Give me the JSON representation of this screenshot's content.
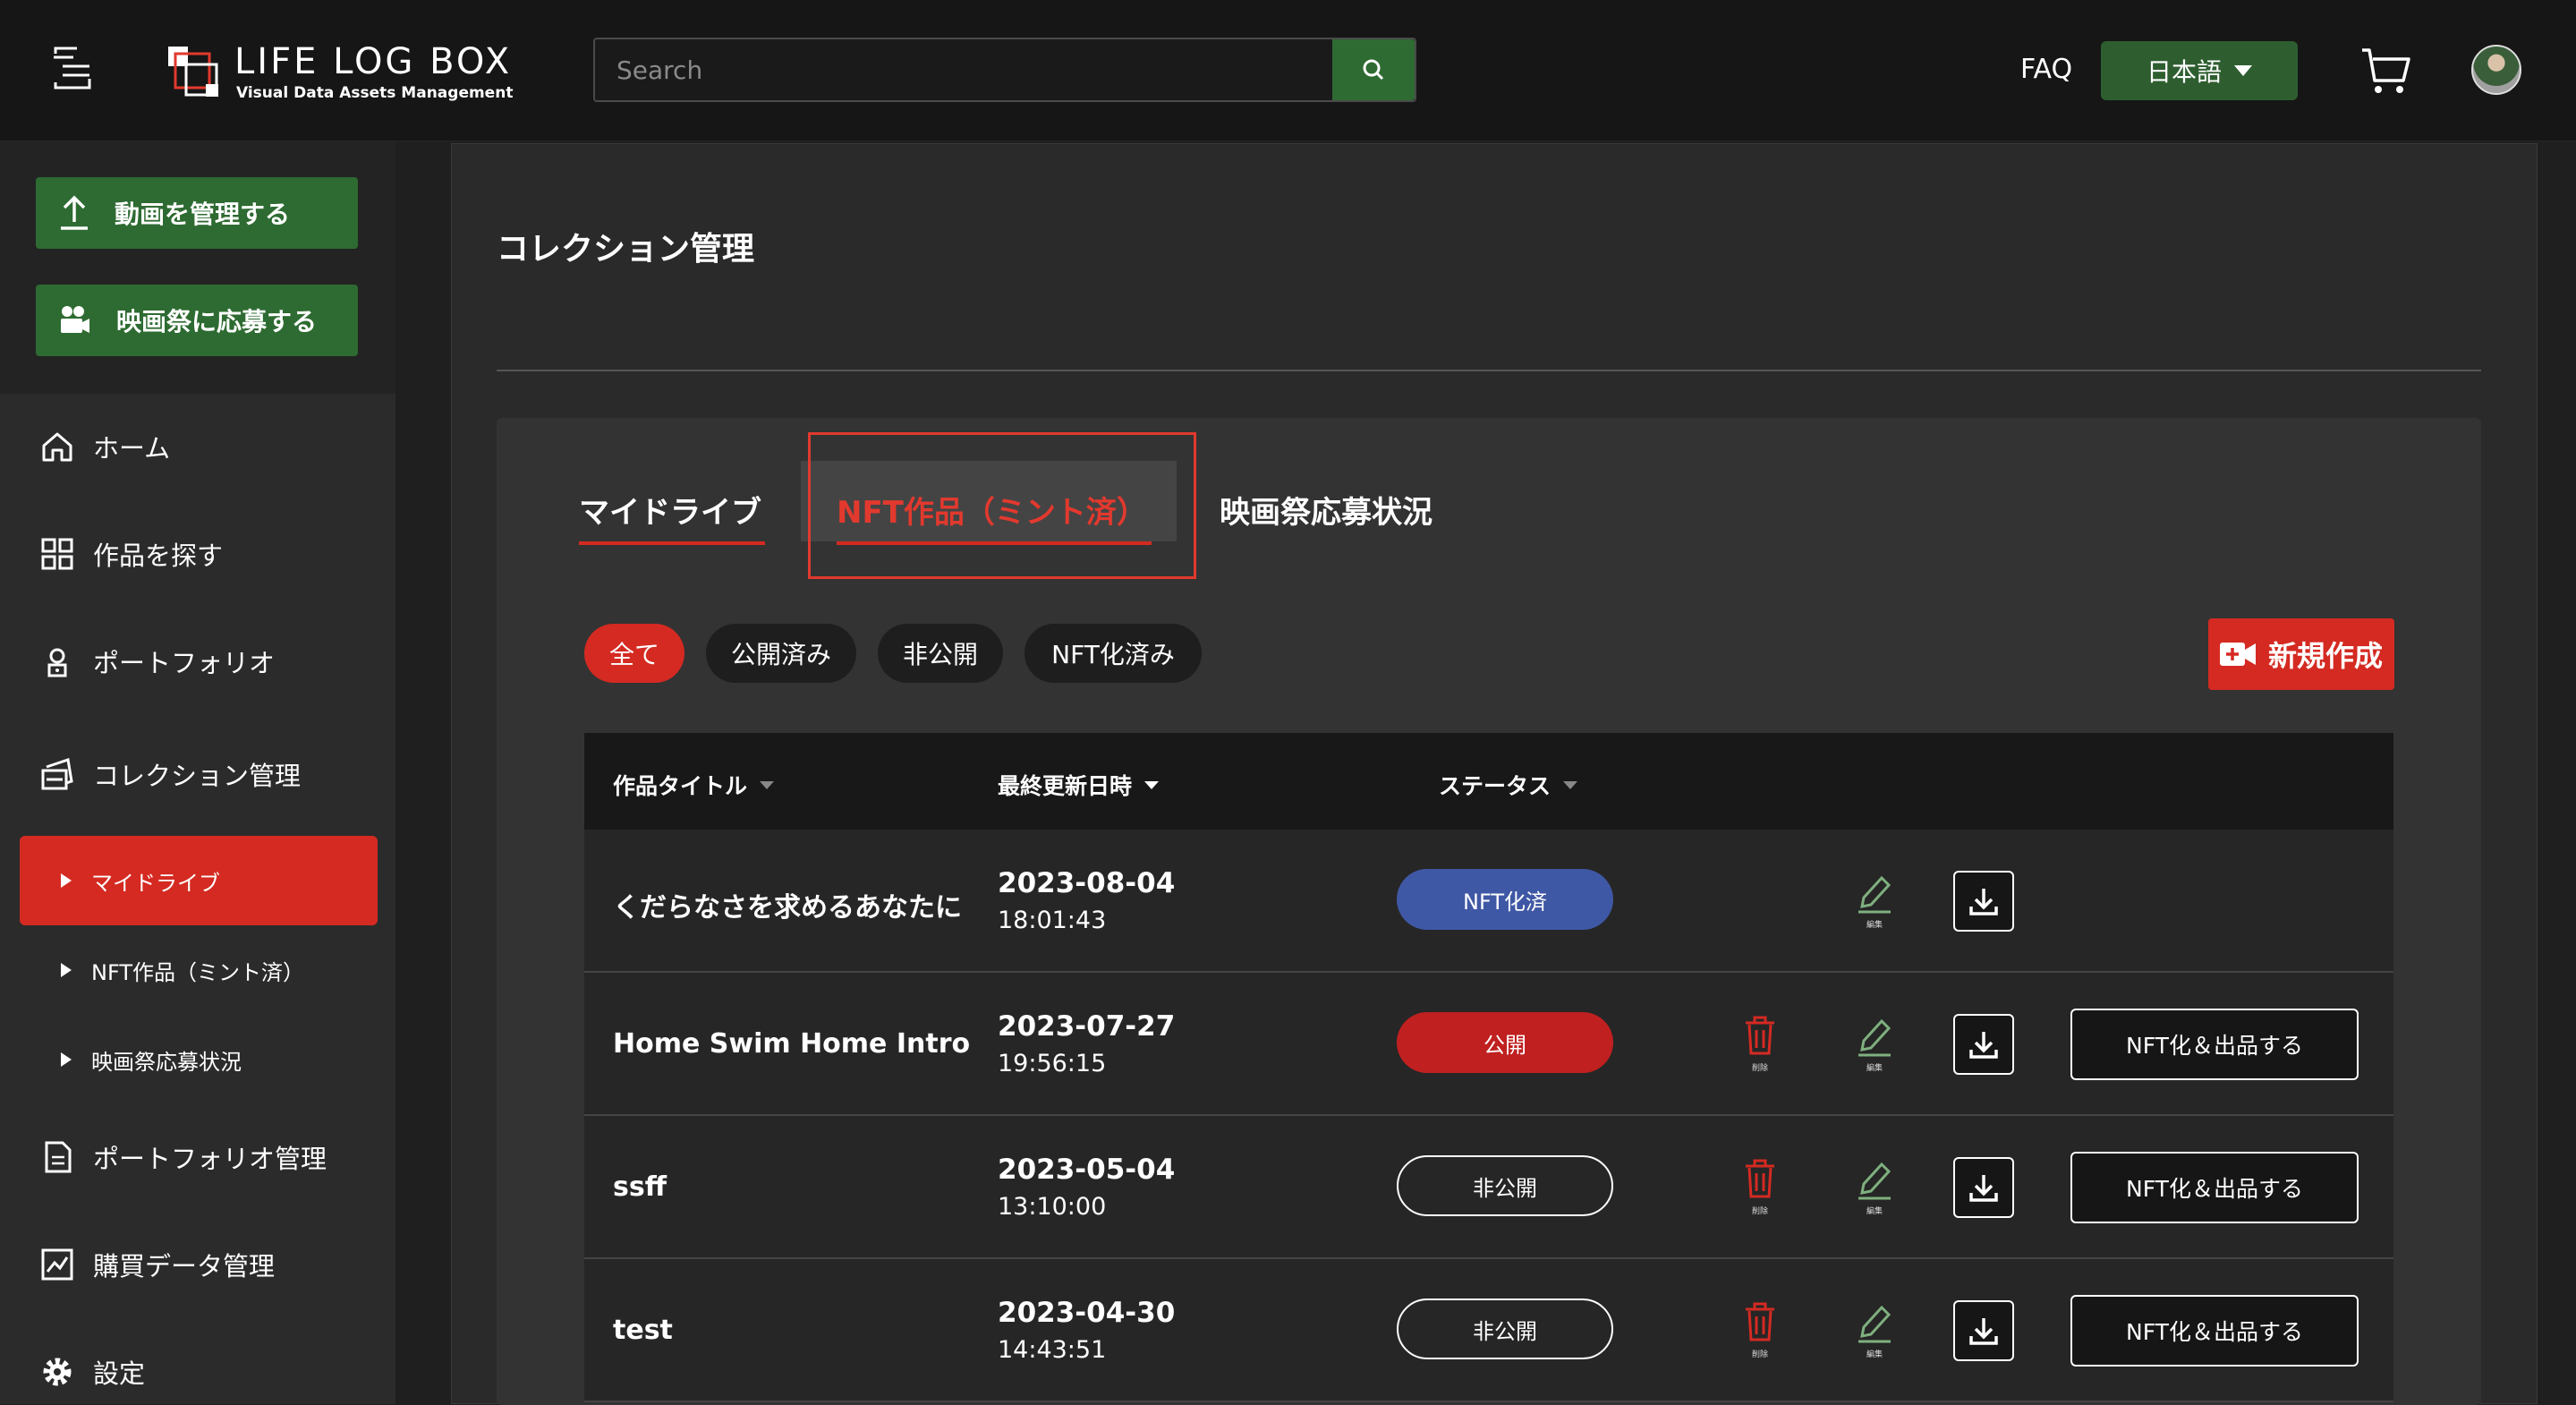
{
  "header": {
    "logo_title": "LIFE LOG BOX",
    "logo_subtitle": "Visual Data Assets Management",
    "search_placeholder": "Search",
    "faq_label": "FAQ",
    "language_label": "日本語"
  },
  "sidebar": {
    "manage_videos": "動画を管理する",
    "apply_festival": "映画祭に応募する",
    "items": [
      {
        "label": "ホーム",
        "icon": "home-icon"
      },
      {
        "label": "作品を探す",
        "icon": "grid-icon"
      },
      {
        "label": "ポートフォリオ",
        "icon": "portfolio-icon"
      },
      {
        "label": "コレクション管理",
        "icon": "collection-icon"
      },
      {
        "label": "ポートフォリオ管理",
        "icon": "document-icon"
      },
      {
        "label": "購買データ管理",
        "icon": "chart-icon"
      },
      {
        "label": "設定",
        "icon": "gear-icon"
      }
    ],
    "subitems": [
      {
        "label": "マイドライブ"
      },
      {
        "label": "NFT作品（ミント済）"
      },
      {
        "label": "映画祭応募状況"
      }
    ]
  },
  "main": {
    "title": "コレクション管理",
    "tabs": [
      {
        "label": "マイドライブ"
      },
      {
        "label": "NFT作品（ミント済）"
      },
      {
        "label": "映画祭応募状況"
      }
    ],
    "filters": [
      {
        "label": "全て"
      },
      {
        "label": "公開済み"
      },
      {
        "label": "非公開"
      },
      {
        "label": "NFT化済み"
      }
    ],
    "new_button": "新規作成",
    "table": {
      "headers": {
        "title": "作品タイトル",
        "updated": "最終更新日時",
        "status": "ステータス"
      },
      "rows": [
        {
          "title": "くだらなさを求めるあなたに",
          "date": "2023-08-04",
          "time": "18:01:43",
          "status": "NFT化済"
        },
        {
          "title": "Home Swim Home Introduction",
          "date": "2023-07-27",
          "time": "19:56:15",
          "status": "公開",
          "mint": "NFT化＆出品する"
        },
        {
          "title": "ssff",
          "date": "2023-05-04",
          "time": "13:10:00",
          "status": "非公開",
          "mint": "NFT化＆出品する"
        },
        {
          "title": "test",
          "date": "2023-04-30",
          "time": "14:43:51",
          "status": "非公開",
          "mint": "NFT化＆出品する"
        }
      ],
      "delete_label": "削除",
      "edit_label": "編集"
    }
  },
  "colors": {
    "accent_red": "#d42a22",
    "accent_green": "#2e6b32",
    "nft_blue": "#3f58a5"
  }
}
